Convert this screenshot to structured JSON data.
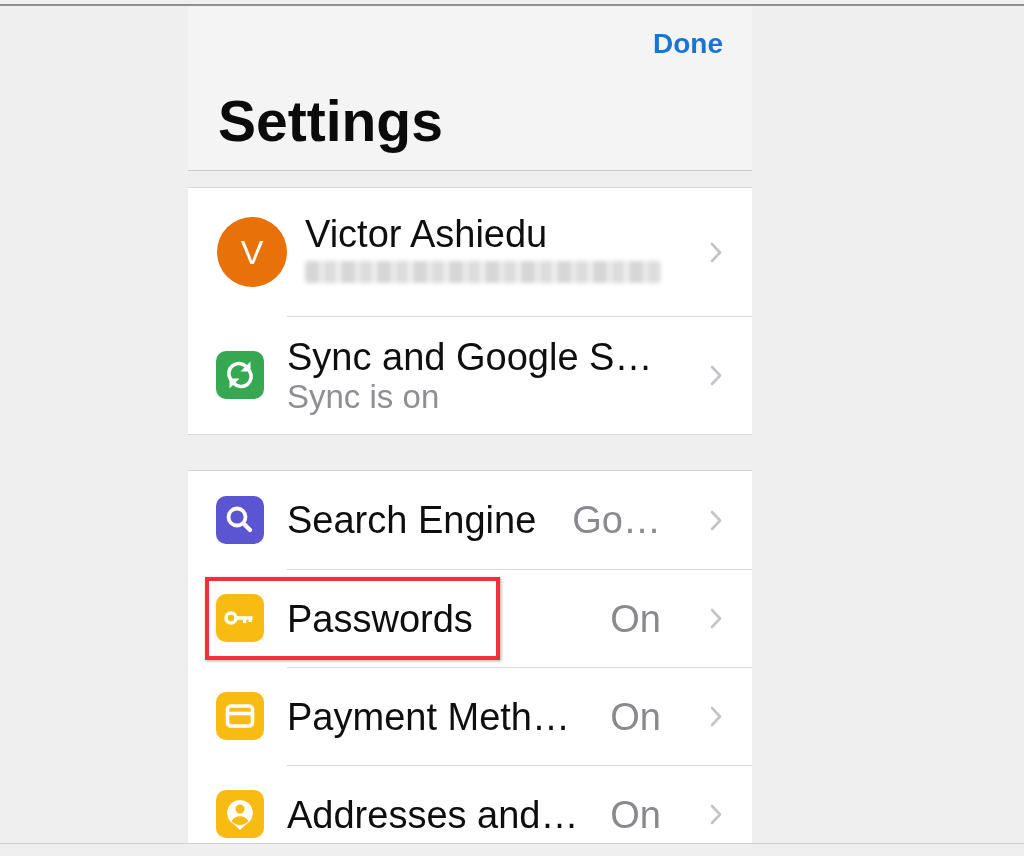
{
  "header": {
    "action": "Done",
    "title": "Settings"
  },
  "groups": [
    {
      "rows": [
        {
          "kind": "account",
          "initial": "V",
          "color": "#e8710a",
          "title": "Victor Ashiedu",
          "email_blurred": true,
          "highlighted": false
        },
        {
          "kind": "sync",
          "color": "#36a852",
          "title": "Sync and Google S…",
          "subtitle": "Sync is on",
          "highlighted": false
        }
      ]
    },
    {
      "rows": [
        {
          "kind": "search",
          "color": "#5b55d1",
          "title": "Search Engine",
          "value": "Go…",
          "highlighted": false
        },
        {
          "kind": "passwords",
          "color": "#f7bb12",
          "title": "Passwords",
          "value": "On",
          "highlighted": true
        },
        {
          "kind": "payment",
          "color": "#f7bb12",
          "title": "Payment Meth…",
          "value": "On",
          "highlighted": false
        },
        {
          "kind": "addresses",
          "color": "#f7bb12",
          "title": "Addresses and…",
          "value": "On",
          "highlighted": false
        }
      ]
    }
  ]
}
